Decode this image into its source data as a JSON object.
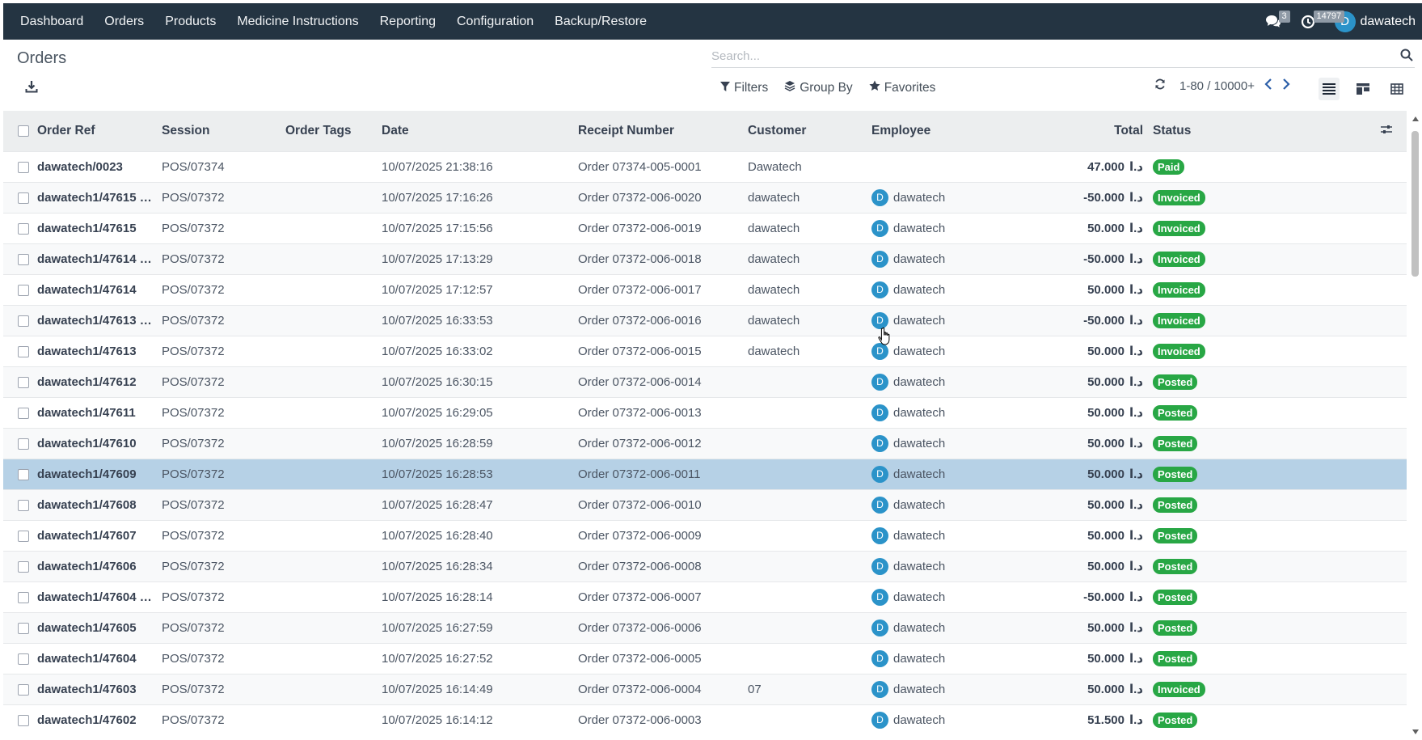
{
  "navbar": {
    "menu": [
      "Dashboard",
      "Orders",
      "Products",
      "Medicine Instructions",
      "Reporting",
      "Configuration",
      "Backup/Restore"
    ],
    "messages_count": "3",
    "activities_count": "14797",
    "user_initial": "D",
    "user_name": "dawatech"
  },
  "control_panel": {
    "title": "Orders",
    "search_placeholder": "Search...",
    "filters_label": "Filters",
    "group_by_label": "Group By",
    "favorites_label": "Favorites",
    "pager_value": "1-80 / 10000+",
    "active_view": "list"
  },
  "table": {
    "columns": [
      "Order Ref",
      "Session",
      "Order Tags",
      "Date",
      "Receipt Number",
      "Customer",
      "Employee",
      "Total",
      "Status"
    ],
    "currency": "د.ا",
    "rows": [
      {
        "ref": "dawatech/0023",
        "session": "POS/07374",
        "tags": "",
        "date": "10/07/2025 21:38:16",
        "receipt": "Order 07374-005-0001",
        "customer": "Dawatech",
        "employee": "",
        "total": "47.000",
        "status": "Paid"
      },
      {
        "ref": "dawatech1/47615 REF...",
        "session": "POS/07372",
        "tags": "",
        "date": "10/07/2025 17:16:26",
        "receipt": "Order 07372-006-0020",
        "customer": "dawatech",
        "employee": "dawatech",
        "total": "-50.000",
        "status": "Invoiced"
      },
      {
        "ref": "dawatech1/47615",
        "session": "POS/07372",
        "tags": "",
        "date": "10/07/2025 17:15:56",
        "receipt": "Order 07372-006-0019",
        "customer": "dawatech",
        "employee": "dawatech",
        "total": "50.000",
        "status": "Invoiced"
      },
      {
        "ref": "dawatech1/47614 REF...",
        "session": "POS/07372",
        "tags": "",
        "date": "10/07/2025 17:13:29",
        "receipt": "Order 07372-006-0018",
        "customer": "dawatech",
        "employee": "dawatech",
        "total": "-50.000",
        "status": "Invoiced"
      },
      {
        "ref": "dawatech1/47614",
        "session": "POS/07372",
        "tags": "",
        "date": "10/07/2025 17:12:57",
        "receipt": "Order 07372-006-0017",
        "customer": "dawatech",
        "employee": "dawatech",
        "total": "50.000",
        "status": "Invoiced"
      },
      {
        "ref": "dawatech1/47613 REF...",
        "session": "POS/07372",
        "tags": "",
        "date": "10/07/2025 16:33:53",
        "receipt": "Order 07372-006-0016",
        "customer": "dawatech",
        "employee": "dawatech",
        "total": "-50.000",
        "status": "Invoiced"
      },
      {
        "ref": "dawatech1/47613",
        "session": "POS/07372",
        "tags": "",
        "date": "10/07/2025 16:33:02",
        "receipt": "Order 07372-006-0015",
        "customer": "dawatech",
        "employee": "dawatech",
        "total": "50.000",
        "status": "Invoiced"
      },
      {
        "ref": "dawatech1/47612",
        "session": "POS/07372",
        "tags": "",
        "date": "10/07/2025 16:30:15",
        "receipt": "Order 07372-006-0014",
        "customer": "",
        "employee": "dawatech",
        "total": "50.000",
        "status": "Posted"
      },
      {
        "ref": "dawatech1/47611",
        "session": "POS/07372",
        "tags": "",
        "date": "10/07/2025 16:29:05",
        "receipt": "Order 07372-006-0013",
        "customer": "",
        "employee": "dawatech",
        "total": "50.000",
        "status": "Posted"
      },
      {
        "ref": "dawatech1/47610",
        "session": "POS/07372",
        "tags": "",
        "date": "10/07/2025 16:28:59",
        "receipt": "Order 07372-006-0012",
        "customer": "",
        "employee": "dawatech",
        "total": "50.000",
        "status": "Posted"
      },
      {
        "ref": "dawatech1/47609",
        "session": "POS/07372",
        "tags": "",
        "date": "10/07/2025 16:28:53",
        "receipt": "Order 07372-006-0011",
        "customer": "",
        "employee": "dawatech",
        "total": "50.000",
        "status": "Posted",
        "selected": true
      },
      {
        "ref": "dawatech1/47608",
        "session": "POS/07372",
        "tags": "",
        "date": "10/07/2025 16:28:47",
        "receipt": "Order 07372-006-0010",
        "customer": "",
        "employee": "dawatech",
        "total": "50.000",
        "status": "Posted"
      },
      {
        "ref": "dawatech1/47607",
        "session": "POS/07372",
        "tags": "",
        "date": "10/07/2025 16:28:40",
        "receipt": "Order 07372-006-0009",
        "customer": "",
        "employee": "dawatech",
        "total": "50.000",
        "status": "Posted"
      },
      {
        "ref": "dawatech1/47606",
        "session": "POS/07372",
        "tags": "",
        "date": "10/07/2025 16:28:34",
        "receipt": "Order 07372-006-0008",
        "customer": "",
        "employee": "dawatech",
        "total": "50.000",
        "status": "Posted"
      },
      {
        "ref": "dawatech1/47604 REF...",
        "session": "POS/07372",
        "tags": "",
        "date": "10/07/2025 16:28:14",
        "receipt": "Order 07372-006-0007",
        "customer": "",
        "employee": "dawatech",
        "total": "-50.000",
        "status": "Posted"
      },
      {
        "ref": "dawatech1/47605",
        "session": "POS/07372",
        "tags": "",
        "date": "10/07/2025 16:27:59",
        "receipt": "Order 07372-006-0006",
        "customer": "",
        "employee": "dawatech",
        "total": "50.000",
        "status": "Posted"
      },
      {
        "ref": "dawatech1/47604",
        "session": "POS/07372",
        "tags": "",
        "date": "10/07/2025 16:27:52",
        "receipt": "Order 07372-006-0005",
        "customer": "",
        "employee": "dawatech",
        "total": "50.000",
        "status": "Posted"
      },
      {
        "ref": "dawatech1/47603",
        "session": "POS/07372",
        "tags": "",
        "date": "10/07/2025 16:14:49",
        "receipt": "Order 07372-006-0004",
        "customer": "07",
        "employee": "dawatech",
        "total": "50.000",
        "status": "Invoiced"
      },
      {
        "ref": "dawatech1/47602",
        "session": "POS/07372",
        "tags": "",
        "date": "10/07/2025 16:14:12",
        "receipt": "Order 07372-006-0003",
        "customer": "",
        "employee": "dawatech",
        "total": "51.500",
        "status": "Posted"
      }
    ]
  },
  "colors": {
    "navbar_bg": "#243442",
    "status_badge": "#28a745",
    "selected_row": "#b6d1e6",
    "avatar": "#2b93c9"
  }
}
